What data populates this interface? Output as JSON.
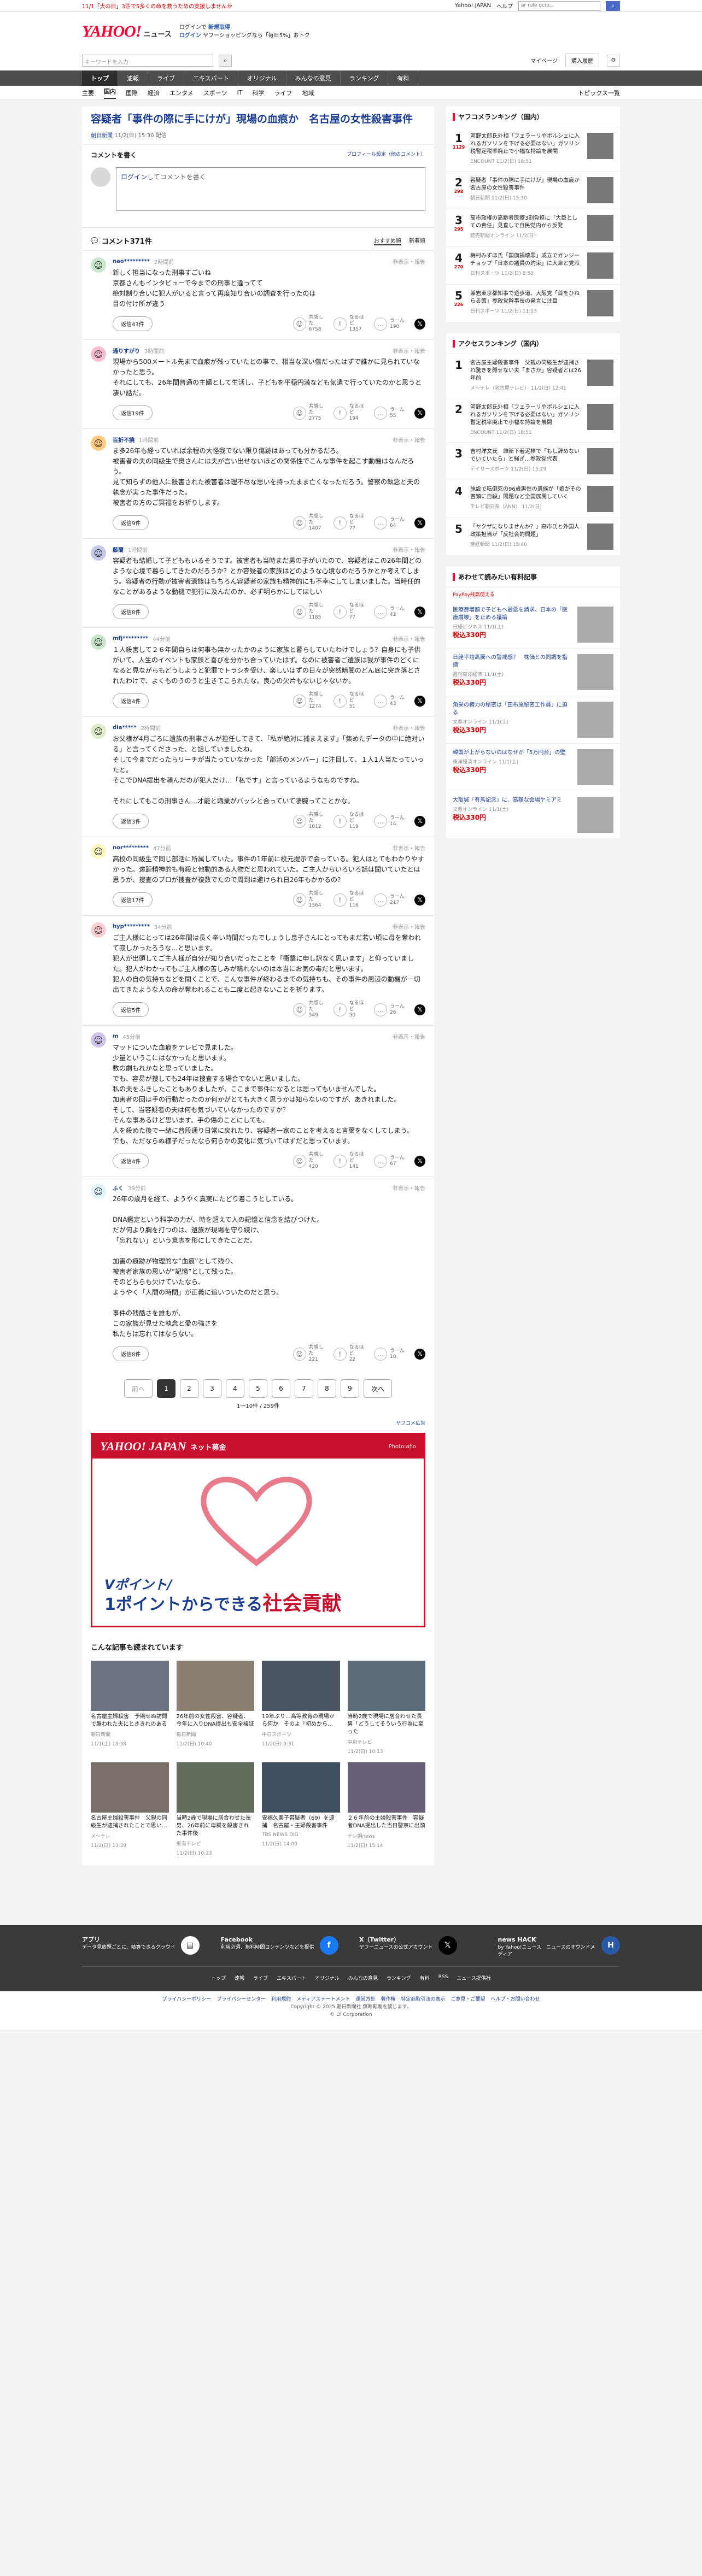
{
  "topbar": {
    "notice": "11/1「犬の日」3匹で5多くの命を救うための支援しませんか",
    "links": [
      "Yahoo! JAPAN",
      "ヘルプ"
    ],
    "search_placeholder": "ウェブ全体",
    "search_value": "ar rule octo..."
  },
  "header": {
    "logo": "YAHOO!",
    "logo_sub": "JAPAN",
    "service": "ニュース",
    "promo_line1": "ログインで",
    "promo_line2": "新規取得",
    "promo_line3": "ログイン",
    "promo_line4": "ヤフーショッピングなら「毎日5%」おトク"
  },
  "search": {
    "placeholder": "キーワードを入力",
    "my_page": "マイページ",
    "purchase": "購入履歴"
  },
  "nav1": [
    "トップ",
    "速報",
    "ライブ",
    "エキスパート",
    "オリジナル",
    "みんなの意見",
    "ランキング",
    "有料"
  ],
  "nav2": [
    "主要",
    "国内",
    "国際",
    "経済",
    "エンタメ",
    "スポーツ",
    "IT",
    "科学",
    "ライフ",
    "地域"
  ],
  "nav2_right": "トピックス一覧",
  "article": {
    "title": "容疑者「事件の際に手にけが」現場の血痕か　名古屋の女性殺害事件",
    "source": "朝日新聞",
    "time": "11/2(日) 15:30 配信"
  },
  "comment_form": {
    "heading": "コメントを書く",
    "profile_link": "プロフィール設定（他のコメント）",
    "login_link": "ログイン",
    "placeholder": "してコメントを書く"
  },
  "comments_header": {
    "title": "コメント371件",
    "sort_recommended": "おすすめ順",
    "sort_new": "新着順"
  },
  "comments": [
    {
      "name": "nao*********",
      "time": "2時間前",
      "text": "新しく担当になった刑事すごいね\n京都さんもインタビューで今までの刑事と違ってて\n絶対制り合いに犯人がいると言って再度知り合いの調査を行ったのは\n目の付け所が違う",
      "replies": "返信43件",
      "r1": "6758",
      "r2": "1357",
      "r3": "190",
      "color": "#c8e6c9"
    },
    {
      "name": "通りすがり",
      "time": "3時間前",
      "text": "現場から500メートル先まで血痕が残っていたとの事で、相当な深い傷だったはずで誰かに見られていなかったと思う。\nそれにしても、26年間普通の主婦として生活し、子どもを平穏円満なども気遣で行っていたのかと思うと凄い話だ。",
      "replies": "返信19件",
      "r1": "2775",
      "r2": "194",
      "r3": "55",
      "color": "#f8bbd0"
    },
    {
      "name": "百折不撓",
      "time": "1時間前",
      "text": "ま多26年も経っていれば余程の大怪我でない限り傷跡はあっても分かるだろ。\n被害者の夫の同級生で奥さんには夫が言い出せないほどの関係性でこんな事件を起こす動機はなんだろう。\n見て知らずの他人に殺害された被害者は理不尽な思いを持ったまま亡くなっただろう。警察の執念と夫の執念が実った事件だった。\n被害者の方のご冥福をお祈りします。",
      "replies": "返信9件",
      "r1": "1407",
      "r2": "77",
      "r3": "64",
      "color": "#ffcc80"
    },
    {
      "name": "藤蘭",
      "time": "1時間前",
      "text": "容疑者も結婚して子どももいるそうです。被害者も当時まだ男の子がいたので、容疑者はこの26年間どのような心境で暮らしてきたのだろうか？とか容疑者の家族はどのような心境なのだろうかとか考えてしまう。容疑者の行動が被害者遺族はもちろん容疑者の家族も精神的にも不幸にしてしまいました。当時任的なことがあるような動機で犯行に及んだのか、必ず明らかにしてほしい",
      "replies": "返信8件",
      "r1": "1185",
      "r2": "77",
      "r3": "42",
      "color": "#c5cae9"
    },
    {
      "name": "mfj*********",
      "time": "44分前",
      "text": "１人殺害して２６年間自らは何事も無かったかのように家族と暮らしていたわけでしょう？自身にも子供がいて、人生のイベントも家族と喜びを分かち合っていたはず。なのに被害者ご遺族は我が事件のどくになると見ながらもどうしようと犯罪でトラシを受け、楽しいはずの日々が突然暗闇のどん底に突き落とされたわけで、よくものうのうと生きてこられたな。良心の欠片もないじゃないか。",
      "replies": "返信4件",
      "r1": "1274",
      "r2": "51",
      "r3": "43",
      "color": "#c8e6c9"
    },
    {
      "name": "dia*****",
      "time": "2時間前",
      "text": "お父様が4月ごろに遺族の刑事さんが担任してきて、「私が絶対に捕まえます」「集めたデータの中に絶対いる」と言ってくださった、と話していましたね。\nそして今までだったらリーチが当たっていなかった「部活のメンバー」に注目して、１人1人当たっていったと。\nそこでDNA提出を頼んだのが犯人だけ…「私です」と言っているようなものですね。\n\nそれにしてもこの刑事さん…才能と職業がバッシと合っていて凄腕ってことかな。",
      "replies": "返信3件",
      "r1": "1012",
      "r2": "119",
      "r3": "14",
      "color": "#dcedc8"
    },
    {
      "name": "nor*********",
      "time": "47分前",
      "text": "高校の同級生で同じ部活に所属していた。事件の1年前に校元提示で会っている。犯人はとてもわかりやすかった。遠距精神的も有殺と他動的ある人物だと思われていた。ご主人からいろいろ話は聞いていたとは思うが、捜査のプロが捜査が複数でたので周到は避けられ日26年もかかるの？",
      "replies": "返信17件",
      "r1": "1364",
      "r2": "116",
      "r3": "217",
      "color": "#fff9c4"
    },
    {
      "name": "hyp*********",
      "time": "34分前",
      "text": "ご主人様にとっては26年間は長く辛い時間だったでしょうし息子さんにとってもまだ若い頃に母を奪われて寂しかったろうな…と思います。\n犯人が出頭してご主人様が自分が知り合いだったことを「衝撃に申し訳なく思います」と仰っていました。犯人がわかってもご主人様の苦しみが晴れないのは本当にお気の毒だと思います。\n犯人の自の気持ちなどを聞くことで、こんな事件が終わるまでの気持ちも、その事件の周辺の動機が一切出てきたような人の命が奪われることも二度と起きないことを祈ります。",
      "replies": "返信5件",
      "r1": "549",
      "r2": "50",
      "r3": "26",
      "color": "#ffcdd2"
    },
    {
      "name": "m",
      "time": "45分前",
      "text": "マットについた血痕をテレビで見ました。\n少量というこにはなかったと思います。\n数の劇もれかなと思っていました。\nでも、容易が捜しても24年は捜査する場合でないと思いました。\n私の夫をふきしたこともありましたが、ここまで事件になるとは思ってもいませんでした。\n加害者の回は手の行動だったのか何かがとても大きく思うかは知らないのですが、あきれました。\nそして、当容疑者の夫は何も気づいていなかったのですか？\nそんな事あるけど思います。手の傷のことにしても、\n人を殺めた後で一緒に普段通り日常に戻れたり、容疑者一家のことを考えると言葉をなくしてしまう。\nでも、ただならぬ様子だったなら何らかの変化に気づいてはずだと思っています。",
      "replies": "返信4件",
      "r1": "420",
      "r2": "141",
      "r3": "67",
      "color": "#d1c4e9"
    },
    {
      "name": "ふく",
      "time": "39分前",
      "text": "26年の歳月を経て、ようやく真実にたどり着こうとしている。\n\nDNA鑑定という科学の力が、時を超えて人の記憶と信念を結びつけた。\nだが何より胸を打つのは、遺族が現場を守り続け、\n「忘れない」という意志を形にしてきたことだ。\n\n加害の痕跡が物理的な“血痕”として残り、\n被害者家族の思いが“記憶”として残った。\nそのどちらも欠けていたなら、\nようやく「人間の時間」が正義に追いついたのだと思う。\n\n事件の残酷さを誰もが、\nこの家族が見せた執念と愛の強さを\n私たちは忘れてはならない。",
      "replies": "返信8件",
      "r1": "221",
      "r2": "22",
      "r3": "10",
      "color": "#e1f5fe"
    }
  ],
  "reaction_labels": {
    "r1": "共感した",
    "r2": "なるほど",
    "r3": "うーん"
  },
  "reply_report": "非表示・報告",
  "pager": {
    "prev": "前へ",
    "pages": [
      "1",
      "2",
      "3",
      "4",
      "5",
      "6",
      "7",
      "8",
      "9"
    ],
    "next": "次へ",
    "count": "1〜10件 / 259件"
  },
  "sponsor": "ヤフコメ広告",
  "ad": {
    "brand": "YAHOO! JAPAN",
    "service": "ネット募金",
    "photo": "Photo:afio",
    "line1": "Vポイント/",
    "line2a": "1ポイントからできる",
    "line2b": "社会貢献"
  },
  "related": {
    "title": "こんな記事も読まれています",
    "items": [
      {
        "t": "名古屋主婦殺害　予期せぬ訪問で襲われた夫にとききれのある",
        "s": "朝日新聞",
        "c": "11/1(土) 18:38"
      },
      {
        "t": "26年前の女性殺害、容疑者、今年に入りDNA提出も安全検証",
        "s": "毎日新聞",
        "c": "11/2(日) 10:40"
      },
      {
        "t": "19年ぶり…高等教育の現場から何か　そのよ「初めから…",
        "s": "中日スポーツ",
        "c": "11/2(日) 9:31"
      },
      {
        "t": "当時2歳で現場に居合わせた長男「どうしてそういう行為に至った",
        "s": "中京テレビ",
        "c": "11/2(日) 10:13"
      },
      {
        "t": "名古屋主婦殺害事件　父親の同級生が逮捕されたことで思い…",
        "s": "メ〜テレ",
        "c": "11/2(日) 13:39"
      },
      {
        "t": "当時2歳で現場に居合わせた長男、26年前に母親を殺害された事件後",
        "s": "東海テレビ",
        "c": "11/2(日) 10:23"
      },
      {
        "t": "安福久美子容疑者（69）を逮捕　名古屋・主婦殺害事件",
        "s": "TBS NEWS DIG",
        "c": "11/2(日) 14:00"
      },
      {
        "t": "２６年前の主婦殺害事件　容疑者DNA提出した当日警察に出頭",
        "s": "テレ朝news",
        "c": "11/2(日) 15:14"
      }
    ]
  },
  "ranking": {
    "title": "ヤフコメランキング（国内）",
    "items": [
      {
        "no": "1",
        "c": "1129",
        "t": "河野太郎氏外相「フェラーリやポルシェに入れるガソリンを下げる必要はない」ガソリン税暫定税率廃止で小幅な持論を展開",
        "s": "ENCOUNT 11/2(日) 18:51"
      },
      {
        "no": "2",
        "c": "298",
        "t": "容疑者「事件の際に手にけが」現場の血痕か　名古屋の女性殺害事件",
        "s": "朝日新聞 11/2(日) 15:30"
      },
      {
        "no": "3",
        "c": "295",
        "t": "高市政権の高齢者医療3割負担に「大臣としての責任」見直しで自民党内から反発",
        "s": "読売新聞オンライン 11/2(日)"
      },
      {
        "no": "4",
        "c": "270",
        "t": "梅村みずほ氏「国旗損壊罪」成立でガンジーチョップ「日本の議員の約束」に大衆と党派",
        "s": "日刊スポーツ 11/2(日) 8:53"
      },
      {
        "no": "5",
        "c": "226",
        "t": "兼岩東京都知事で遊歩道、大阪党「首をひねらる策」参政党幹事長の発言に注目",
        "s": "日刊スポーツ 11/2(日) 11:03"
      }
    ]
  },
  "access": {
    "title": "アクセスランキング（国内）",
    "items": [
      {
        "no": "1",
        "t": "名古屋主婦殺害事件　父親の同級生が逮捕され驚きを隠せない夫「まさか」容疑者とは26年前",
        "s": "メ〜テレ（名古屋テレビ） 11/2(日) 12:41"
      },
      {
        "no": "2",
        "t": "河野太郎氏外相「フェラーリやポルシェに入れるガソリンを下げる必要はない」ガソリン暫定税率廃止で小幅な持論を展開",
        "s": "ENCOUNT 11/2(日) 18:51"
      },
      {
        "no": "3",
        "t": "吉村洋文氏　維新下着泥棒で「もし辞めないでいていたら」と騒ぎ…参政党代表",
        "s": "デイリースポーツ 11/2(日) 15:29"
      },
      {
        "no": "4",
        "t": "施設で転倒死の96歳男性の遺族が「娘がその書類に自殺」問題など全国展開していく",
        "s": "テレビ朝日系（ANN） 11/2(日)"
      },
      {
        "no": "5",
        "t": "「ヤクザになりませんか？」高市氏と外国人政策担当が「反社会的問題」",
        "s": "産経新聞 11/2(日) 15:40"
      }
    ]
  },
  "shopping": {
    "title": "あわせて読みたい有料記事",
    "paypay": "PayPay残高使える",
    "items": [
      {
        "t": "医療費増額で子どもへ最悪を請求、日本の「医療崩壊」を止める議論",
        "s": "日経ビジネス 11/1(土)",
        "p": "税込330円"
      },
      {
        "t": "日経平均高騰への警戒感？　株価との同調を指摘",
        "s": "週刊東洋経済 11/1(土)",
        "p": "税込330円"
      },
      {
        "t": "角栄の権力の秘密は「田布施秘密工作員」に迫る",
        "s": "文春オンライン 11/1(土)",
        "p": "税込330円"
      },
      {
        "t": "韓国が上がらないのはなぜか「5万円台」の壁",
        "s": "東洋経済オンライン 11/1(土)",
        "p": "税込330円"
      },
      {
        "t": "大阪城「有馬記念」に、高額な会場ヤミアミ",
        "s": "文春オンライン 11/1(土)",
        "p": "税込330円"
      }
    ]
  },
  "footer": {
    "apps": [
      {
        "t": "アプリ",
        "d": "データ見放題ごとに、精算できるクラウド"
      },
      {
        "t": "Facebook",
        "d": "利用必須、無料時間コンテンツなどを提供"
      },
      {
        "t": "X（Twitter）",
        "d": "ヤフーニュースの公式アカウント"
      },
      {
        "t": "news HACK",
        "d": "by Yahoo!ニュース　ニュースのオウンドメディア"
      }
    ],
    "nav": [
      "トップ",
      "速報",
      "ライブ",
      "エキスパート",
      "オリジナル",
      "みんなの意見",
      "ランキング",
      "有料",
      "RSS",
      "ニュース提供社"
    ],
    "links": [
      "プライバシーポリシー",
      "プライバシーセンター",
      "利用規約",
      "メディアステートメント",
      "運営方針",
      "著作権",
      "特定商取引法の表示",
      "ご意見・ご要望",
      "ヘルプ・お問い合わせ"
    ],
    "copyright1": "Copyright © 2025 朝日新聞社 無断転載を禁じます。",
    "copyright2": "© LY Corporation"
  }
}
